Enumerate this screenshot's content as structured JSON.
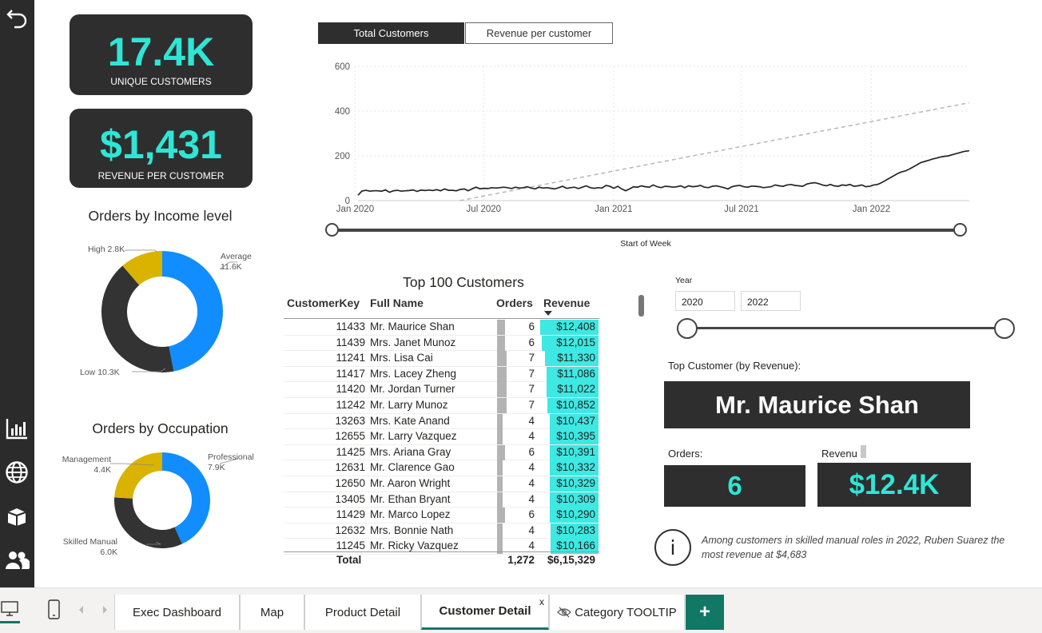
{
  "nav": {
    "back_icon": "back-arrow-icon",
    "icons": [
      "bar-chart-icon",
      "globe-icon",
      "box-icon",
      "users-icon"
    ]
  },
  "kpis": {
    "unique_customers": {
      "value": "17.4K",
      "label": "UNIQUE CUSTOMERS"
    },
    "revenue_per_customer": {
      "value": "$1,431",
      "label": "REVENUE PER CUSTOMER"
    }
  },
  "trend": {
    "toggle": {
      "active": "Total Customers",
      "inactive": "Revenue per customer"
    },
    "slider_label": "Start of Week",
    "y_ticks": [
      "600",
      "400",
      "200",
      "0"
    ],
    "x_ticks": [
      "Jan 2020",
      "Jul 2020",
      "Jan 2021",
      "Jul 2021",
      "Jan 2022"
    ]
  },
  "chart_data": [
    {
      "type": "line",
      "title": "",
      "xlabel": "Start of Week",
      "ylabel": "",
      "ylim": [
        0,
        600
      ],
      "x_range": [
        "2020-01-05",
        "2022-06-26"
      ],
      "series": [
        {
          "values": [
            24,
            43,
            46,
            42,
            44,
            44,
            42,
            48,
            37,
            44,
            46,
            42,
            44,
            45,
            48,
            41,
            47,
            45,
            47,
            45,
            49,
            44,
            52,
            46,
            46,
            44,
            50,
            52,
            44,
            53,
            60,
            53,
            55,
            54,
            58,
            56,
            58,
            60,
            58,
            54,
            60,
            56,
            58,
            62,
            56,
            52,
            60,
            56,
            58,
            55,
            52,
            58,
            64,
            55,
            58,
            60,
            54,
            60,
            66,
            58,
            55,
            58,
            56,
            68,
            64,
            55,
            64,
            52,
            44,
            52,
            62,
            60,
            66,
            62,
            60,
            70,
            62,
            58,
            64,
            63,
            60,
            62,
            66,
            58,
            66,
            62,
            64,
            68,
            60,
            58,
            64,
            66,
            62,
            58,
            52,
            62,
            66,
            68,
            62,
            60,
            65,
            64,
            62,
            58,
            60,
            62,
            70,
            66,
            64,
            70,
            72,
            68,
            66,
            64,
            74,
            78,
            80,
            76,
            70,
            66,
            72,
            66,
            64,
            70,
            68,
            72,
            64,
            66,
            70,
            62,
            64,
            70,
            72,
            80,
            90,
            100,
            110,
            120,
            128,
            132,
            140,
            150,
            160,
            170,
            175,
            180,
            186,
            190,
            195,
            198,
            200,
            205,
            210,
            215,
            220,
            222,
            225,
            230,
            232,
            235,
            240,
            243,
            245
          ]
        }
      ]
    },
    {
      "type": "pie",
      "title": "Orders by Income level",
      "slices": [
        {
          "label": "Average",
          "value": 11.6,
          "display": "11.6K",
          "color": "#118dff"
        },
        {
          "label": "Low",
          "value": 10.3,
          "display": "10.3K",
          "color": "#333333"
        },
        {
          "label": "High",
          "value": 2.8,
          "display": "2.8K",
          "color": "#d9b300"
        }
      ]
    },
    {
      "type": "pie",
      "title": "Orders by Occupation",
      "slices": [
        {
          "label": "Professional",
          "value": 7.9,
          "display": "7.9K",
          "color": "#118dff"
        },
        {
          "label": "Skilled Manual",
          "value": 6.0,
          "display": "6.0K",
          "color": "#333333"
        },
        {
          "label": "Management",
          "value": 4.4,
          "display": "4.4K",
          "color": "#d9b300"
        }
      ]
    }
  ],
  "income": {
    "title": "Orders by Income level",
    "labels": {
      "high_name": "High",
      "high_val": "2.8K",
      "avg_name": "Average",
      "avg_val": "11.6K",
      "low_name": "Low",
      "low_val": "10.3K"
    }
  },
  "occupation": {
    "title": "Orders by Occupation",
    "labels": {
      "mgmt_name": "Management",
      "mgmt_val": "4.4K",
      "prof_name": "Professional",
      "prof_val": "7.9K",
      "skill_name": "Skilled Manual",
      "skill_val": "6.0K"
    }
  },
  "table": {
    "title": "Top 100 Customers",
    "headers": [
      "CustomerKey",
      "Full Name",
      "Orders",
      "Revenue"
    ],
    "rows": [
      [
        "11433",
        "Mr. Maurice Shan",
        "6",
        "$12,408"
      ],
      [
        "11439",
        "Mrs. Janet Munoz",
        "6",
        "$12,015"
      ],
      [
        "11241",
        "Mrs. Lisa Cai",
        "7",
        "$11,330"
      ],
      [
        "11417",
        "Mrs. Lacey Zheng",
        "7",
        "$11,086"
      ],
      [
        "11420",
        "Mr. Jordan Turner",
        "7",
        "$11,022"
      ],
      [
        "11242",
        "Mr. Larry Munoz",
        "7",
        "$10,852"
      ],
      [
        "13263",
        "Mrs. Kate Anand",
        "4",
        "$10,437"
      ],
      [
        "12655",
        "Mr. Larry Vazquez",
        "4",
        "$10,395"
      ],
      [
        "11425",
        "Mrs. Ariana Gray",
        "6",
        "$10,391"
      ],
      [
        "12631",
        "Mr. Clarence Gao",
        "4",
        "$10,332"
      ],
      [
        "12650",
        "Mr. Aaron Wright",
        "4",
        "$10,329"
      ],
      [
        "13405",
        "Mr. Ethan Bryant",
        "4",
        "$10,309"
      ],
      [
        "11429",
        "Mr. Marco Lopez",
        "6",
        "$10,290"
      ],
      [
        "12632",
        "Mrs. Bonnie Nath",
        "4",
        "$10,283"
      ],
      [
        "11245",
        "Mr. Ricky Vazquez",
        "4",
        "$10,166"
      ]
    ],
    "total": {
      "label": "Total",
      "orders": "1,272",
      "revenue": "$6,15,329"
    }
  },
  "filters": {
    "year_label": "Year",
    "year_from": "2020",
    "year_to": "2022"
  },
  "top_customer": {
    "label": "Top Customer (by Revenue):",
    "name": "Mr. Maurice Shan",
    "orders_label": "Orders:",
    "orders_value": "6",
    "revenue_label": "Revenu",
    "revenue_value": "$12.4K"
  },
  "insight": {
    "icon": "info-icon",
    "text": "Among customers in skilled manual roles in 2022, Ruben Suarez the most revenue at $4,683"
  },
  "page_tabs": {
    "tabs": [
      "Exec Dashboard",
      "Map",
      "Product Detail",
      "Customer Detail",
      "Category TOOLTIP"
    ],
    "close_label": "x",
    "add_label": "+",
    "accent": "#117865"
  },
  "colors": {
    "teal": "#2ee6d6",
    "dark": "#2e2e2e",
    "blue": "#118dff",
    "gold": "#d9b300",
    "revenue_bar": "#3ee8e3"
  }
}
